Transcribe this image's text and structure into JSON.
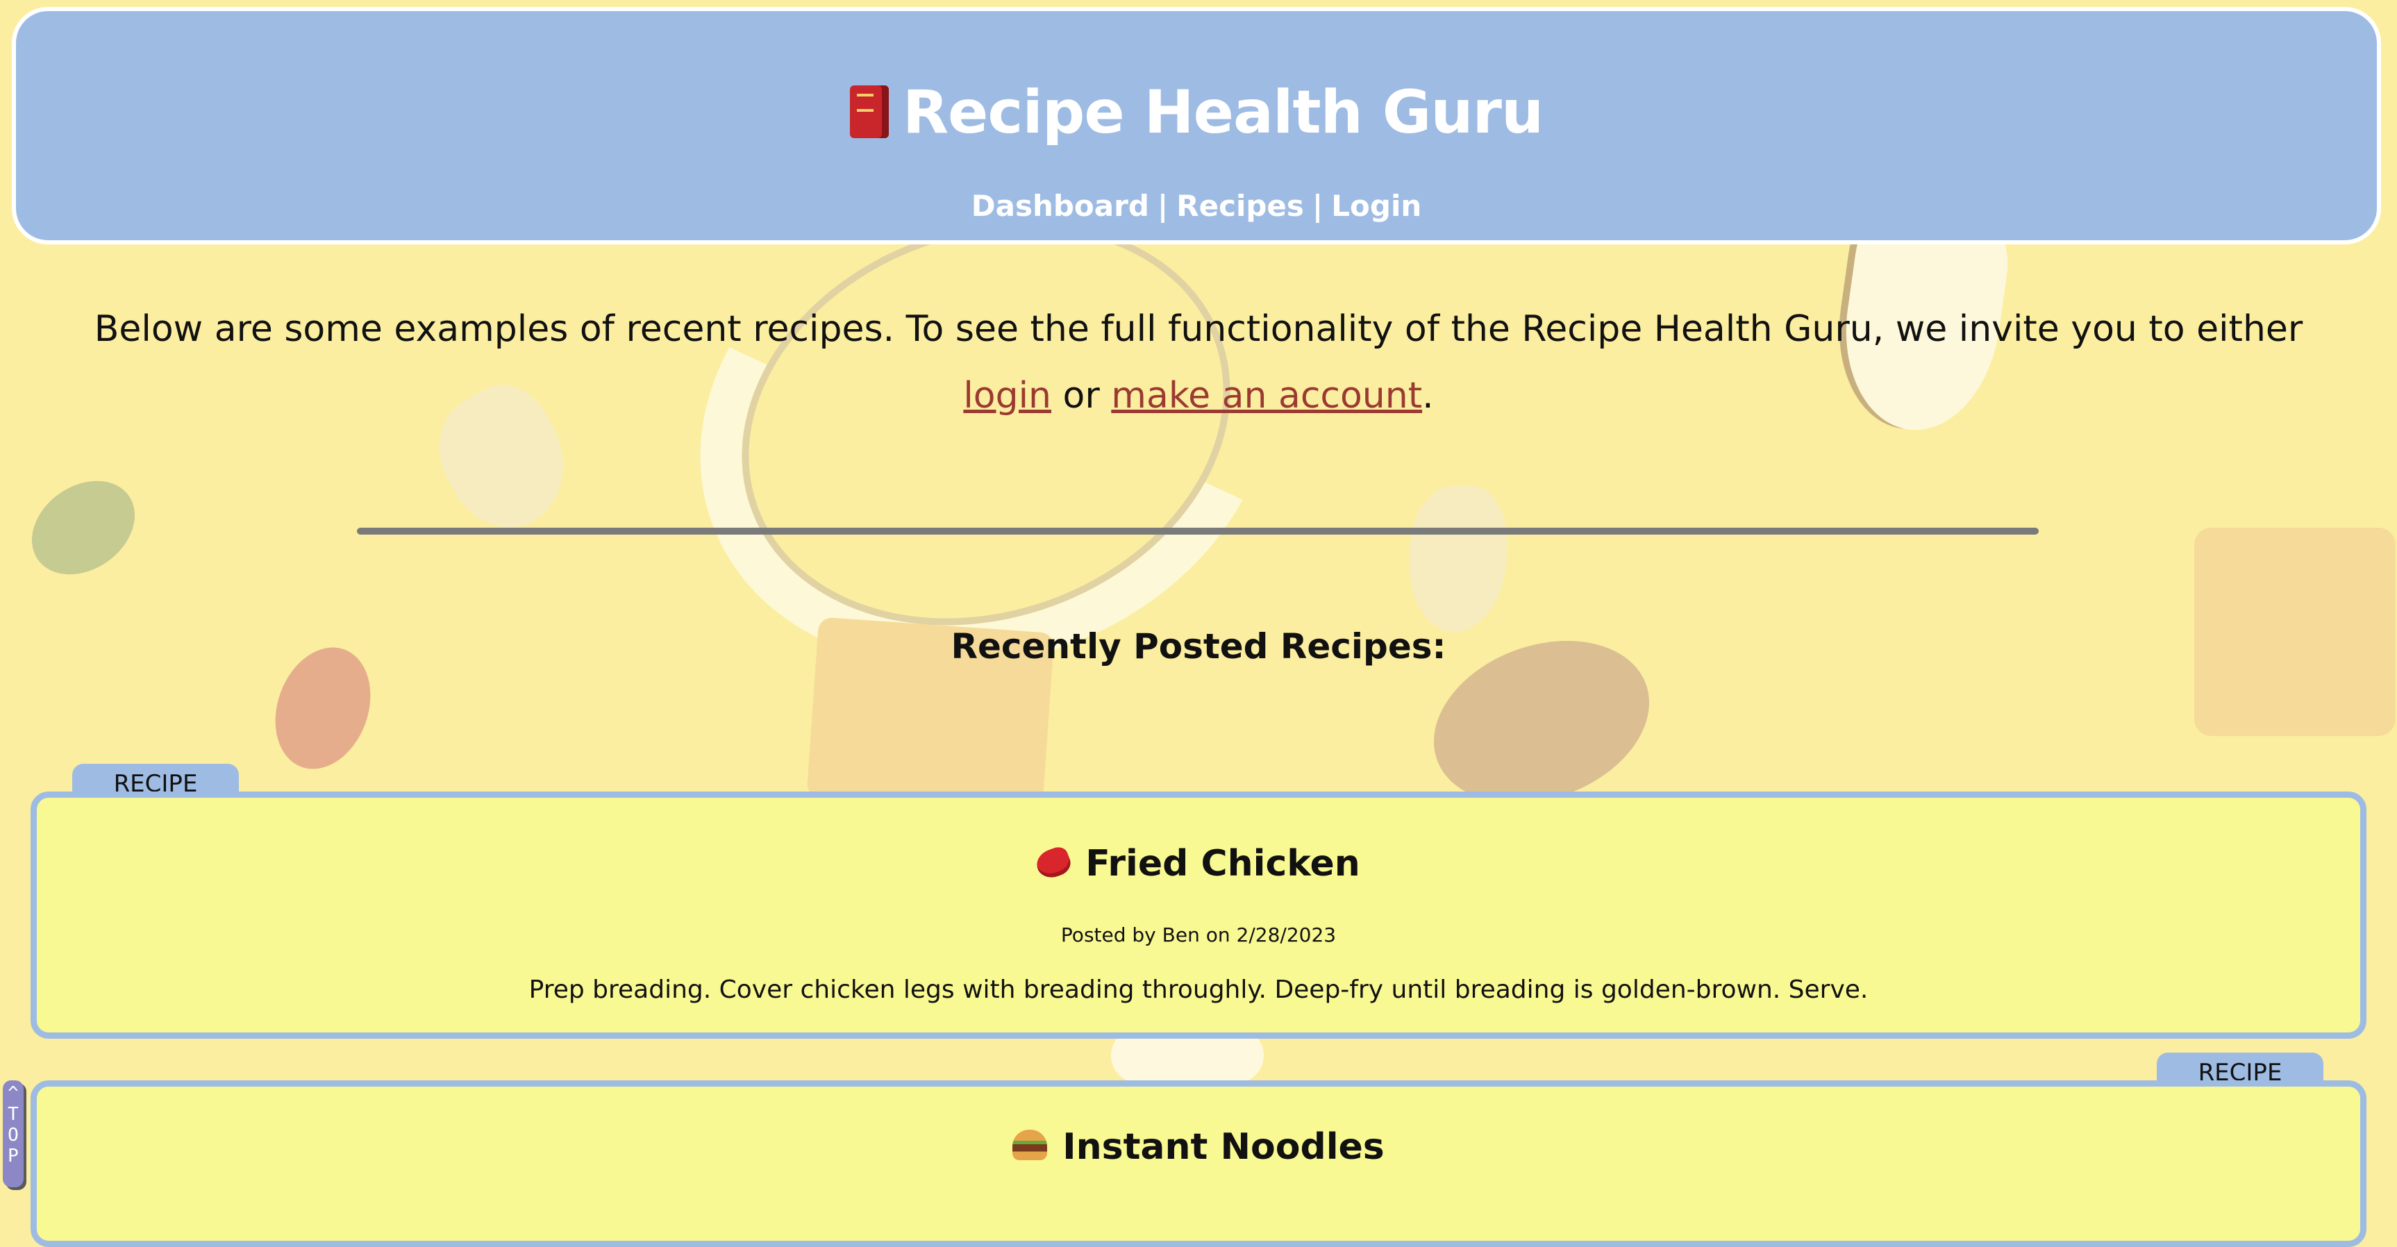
{
  "header": {
    "title": "Recipe Health Guru",
    "title_icon": "book-icon",
    "nav": [
      {
        "label": "Dashboard"
      },
      {
        "label": "Recipes"
      },
      {
        "label": "Login"
      }
    ],
    "nav_separator": "|"
  },
  "intro": {
    "text_before": "Below are some examples of recent recipes. To see the full functionality of the Recipe Health Guru, we invite you to either ",
    "login_link": "login",
    "text_middle": " or ",
    "account_link": "make an account",
    "text_after": "."
  },
  "section_title": "Recently Posted Recipes:",
  "recipes": [
    {
      "tag": "RECIPE",
      "icon": "steak-icon",
      "title": "Fried Chicken",
      "meta": "Posted by Ben on 2/28/2023",
      "body": "Prep breading. Cover chicken legs with breading throughly. Deep-fry until breading is golden-brown. Serve."
    },
    {
      "tag": "RECIPE",
      "icon": "burger-icon",
      "title": "Instant Noodles"
    }
  ],
  "back_to_top": {
    "arrow": "^",
    "letters": [
      "T",
      "O",
      "P"
    ]
  },
  "colors": {
    "header_bg": "#9ebce3",
    "card_bg": "#f9f993",
    "link": "#9b3a32",
    "page_bg": "#fbeea0"
  }
}
